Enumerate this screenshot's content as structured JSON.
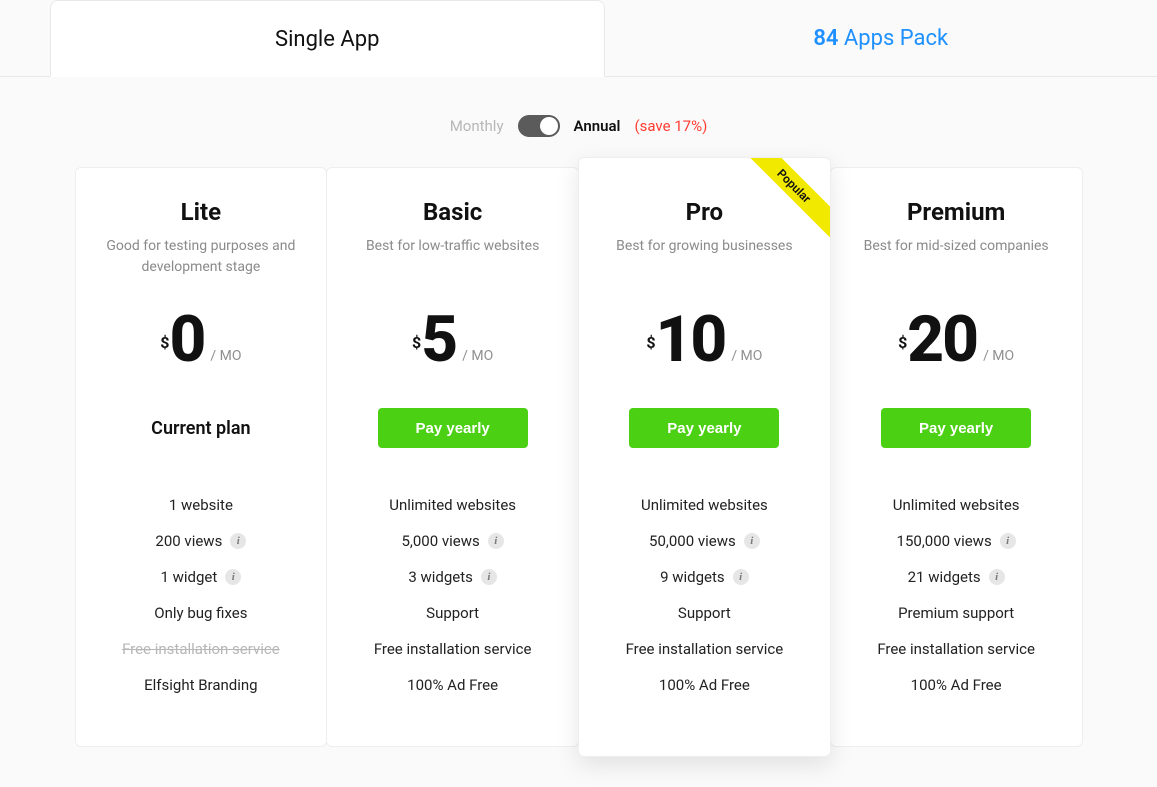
{
  "tabs": {
    "single": "Single App",
    "pack_count": "84",
    "pack_label": "Apps Pack"
  },
  "billing": {
    "monthly": "Monthly",
    "annual": "Annual",
    "save": "(save 17%)"
  },
  "common": {
    "currency": "$",
    "period": "/ MO",
    "pay_button": "Pay yearly",
    "current_plan": "Current plan",
    "popular_ribbon": "Popular"
  },
  "plans": [
    {
      "name": "Lite",
      "tagline": "Good for testing purposes and development stage",
      "price": "0",
      "is_current": true,
      "is_popular": false,
      "features": [
        {
          "text": "1 website",
          "info": false,
          "struck": false
        },
        {
          "text": "200 views",
          "info": true,
          "struck": false
        },
        {
          "text": "1 widget",
          "info": true,
          "struck": false
        },
        {
          "text": "Only bug fixes",
          "info": false,
          "struck": false
        },
        {
          "text": "Free installation service",
          "info": false,
          "struck": true
        },
        {
          "text": "Elfsight Branding",
          "info": false,
          "struck": false
        }
      ]
    },
    {
      "name": "Basic",
      "tagline": "Best for low-traffic websites",
      "price": "5",
      "is_current": false,
      "is_popular": false,
      "features": [
        {
          "text": "Unlimited websites",
          "info": false,
          "struck": false
        },
        {
          "text": "5,000 views",
          "info": true,
          "struck": false
        },
        {
          "text": "3 widgets",
          "info": true,
          "struck": false
        },
        {
          "text": "Support",
          "info": false,
          "struck": false
        },
        {
          "text": "Free installation service",
          "info": false,
          "struck": false
        },
        {
          "text": "100% Ad Free",
          "info": false,
          "struck": false
        }
      ]
    },
    {
      "name": "Pro",
      "tagline": "Best for growing businesses",
      "price": "10",
      "is_current": false,
      "is_popular": true,
      "features": [
        {
          "text": "Unlimited websites",
          "info": false,
          "struck": false
        },
        {
          "text": "50,000 views",
          "info": true,
          "struck": false
        },
        {
          "text": "9 widgets",
          "info": true,
          "struck": false
        },
        {
          "text": "Support",
          "info": false,
          "struck": false
        },
        {
          "text": "Free installation service",
          "info": false,
          "struck": false
        },
        {
          "text": "100% Ad Free",
          "info": false,
          "struck": false
        }
      ]
    },
    {
      "name": "Premium",
      "tagline": "Best for mid-sized companies",
      "price": "20",
      "is_current": false,
      "is_popular": false,
      "features": [
        {
          "text": "Unlimited websites",
          "info": false,
          "struck": false
        },
        {
          "text": "150,000 views",
          "info": true,
          "struck": false
        },
        {
          "text": "21 widgets",
          "info": true,
          "struck": false
        },
        {
          "text": "Premium support",
          "info": false,
          "struck": false
        },
        {
          "text": "Free installation service",
          "info": false,
          "struck": false
        },
        {
          "text": "100% Ad Free",
          "info": false,
          "struck": false
        }
      ]
    }
  ]
}
